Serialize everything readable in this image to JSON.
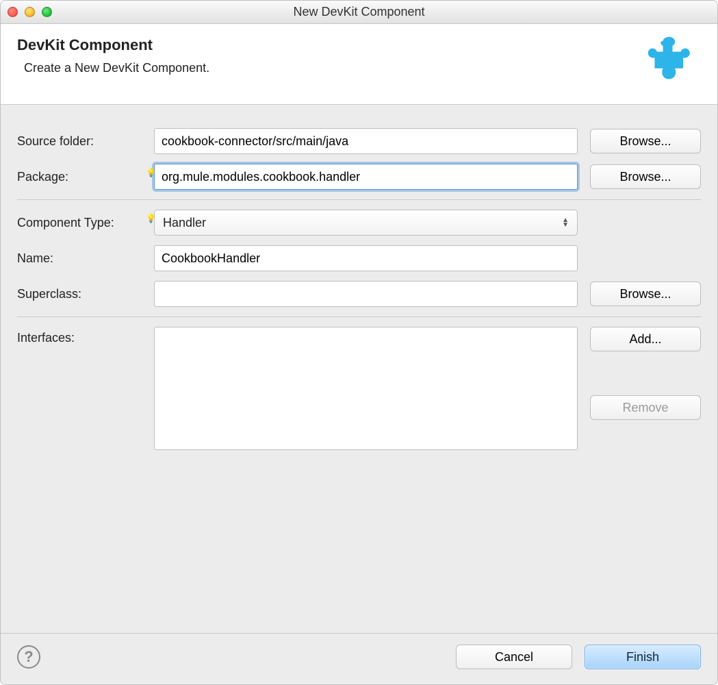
{
  "window": {
    "title": "New DevKit Component"
  },
  "header": {
    "title": "DevKit Component",
    "description": "Create a New DevKit Component."
  },
  "form": {
    "sourceFolder": {
      "label": "Source folder:",
      "value": "cookbook-connector/src/main/java",
      "browse": "Browse..."
    },
    "package": {
      "label": "Package:",
      "value": "org.mule.modules.cookbook.handler",
      "browse": "Browse..."
    },
    "componentType": {
      "label": "Component Type:",
      "value": "Handler"
    },
    "name": {
      "label": "Name:",
      "value": "CookbookHandler"
    },
    "superclass": {
      "label": "Superclass:",
      "value": "",
      "browse": "Browse..."
    },
    "interfaces": {
      "label": "Interfaces:",
      "value": "",
      "add": "Add...",
      "remove": "Remove"
    }
  },
  "footer": {
    "cancel": "Cancel",
    "finish": "Finish",
    "help": "?"
  },
  "icons": {
    "bulb": "💡",
    "arrowUp": "▲",
    "arrowDown": "▼"
  }
}
